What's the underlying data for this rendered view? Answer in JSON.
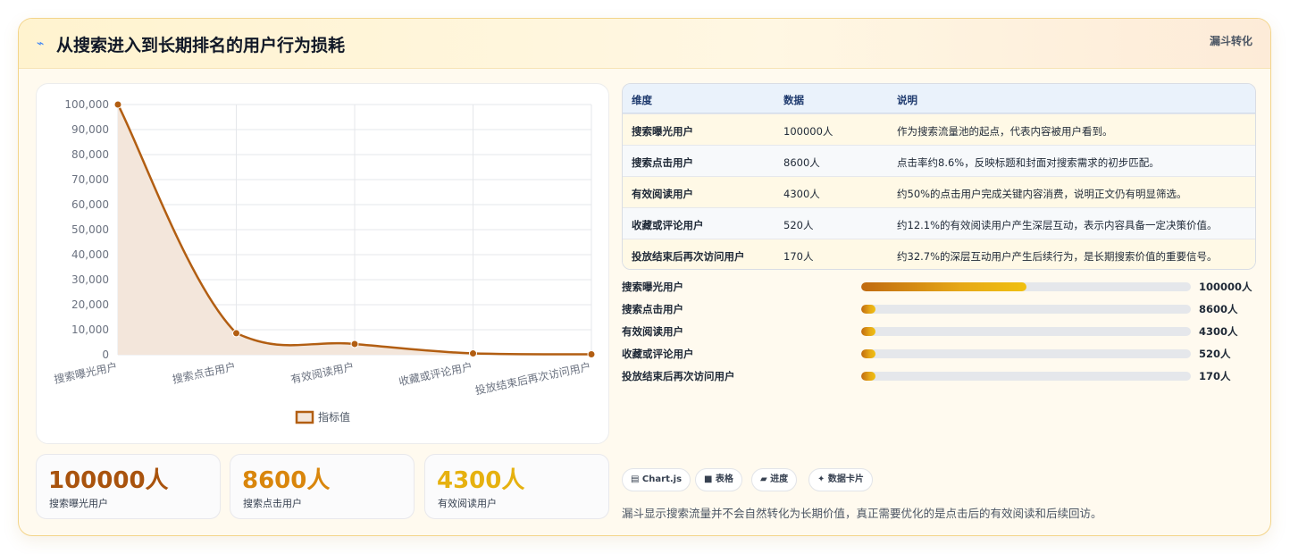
{
  "header": {
    "title": "从搜索进入到长期排名的用户行为损耗",
    "tag": "漏斗转化"
  },
  "chart_data": {
    "type": "area",
    "categories": [
      "搜索曝光用户",
      "搜索点击用户",
      "有效阅读用户",
      "收藏或评论用户",
      "投放结束后再次访问用户"
    ],
    "series": [
      {
        "name": "指标值",
        "values": [
          100000,
          8600,
          4300,
          520,
          170
        ]
      }
    ],
    "yticks": [
      "100,000",
      "90,000",
      "80,000",
      "70,000",
      "60,000",
      "50,000",
      "40,000",
      "30,000",
      "20,000",
      "10,000",
      "0"
    ],
    "ylim": [
      0,
      100000
    ],
    "grid": true,
    "legend": "bottom",
    "colors": {
      "line": "#b25e12",
      "fill": "#f3e6db"
    }
  },
  "stats": [
    {
      "value": "100000人",
      "label": "搜索曝光用户",
      "color": "#a9530d"
    },
    {
      "value": "8600人",
      "label": "搜索点击用户",
      "color": "#d9860c"
    },
    {
      "value": "4300人",
      "label": "有效阅读用户",
      "color": "#e6b10f"
    }
  ],
  "table": {
    "headers": [
      "维度",
      "数据",
      "说明"
    ],
    "rows": [
      [
        "搜索曝光用户",
        "100000人",
        "作为搜索流量池的起点，代表内容被用户看到。"
      ],
      [
        "搜索点击用户",
        "8600人",
        "点击率约8.6%，反映标题和封面对搜索需求的初步匹配。"
      ],
      [
        "有效阅读用户",
        "4300人",
        "约50%的点击用户完成关键内容消费，说明正文仍有明显筛选。"
      ],
      [
        "收藏或评论用户",
        "520人",
        "约12.1%的有效阅读用户产生深层互动，表示内容具备一定决策价值。"
      ],
      [
        "投放结束后再次访问用户",
        "170人",
        "约32.7%的深层互动用户产生后续行为，是长期搜索价值的重要信号。"
      ]
    ]
  },
  "progress": [
    {
      "label": "搜索曝光用户",
      "value": "100000人",
      "fraction": 0.5
    },
    {
      "label": "搜索点击用户",
      "value": "8600人",
      "fraction": 0.043
    },
    {
      "label": "有效阅读用户",
      "value": "4300人",
      "fraction": 0.043
    },
    {
      "label": "收藏或评论用户",
      "value": "520人",
      "fraction": 0.043
    },
    {
      "label": "投放结束后再次访问用户",
      "value": "170人",
      "fraction": 0.043
    }
  ],
  "chips": [
    {
      "icon": "chart-icon",
      "label": "▤ Chart.js"
    },
    {
      "icon": "table-icon",
      "label": "■ 表格"
    },
    {
      "icon": "progress-icon",
      "label": "▰ 进度"
    },
    {
      "icon": "card-icon",
      "label": "✦ 数据卡片"
    }
  ],
  "note": "漏斗显示搜索流量并不会自然转化为长期价值，真正需要优化的是点击后的有效阅读和后续回访。"
}
